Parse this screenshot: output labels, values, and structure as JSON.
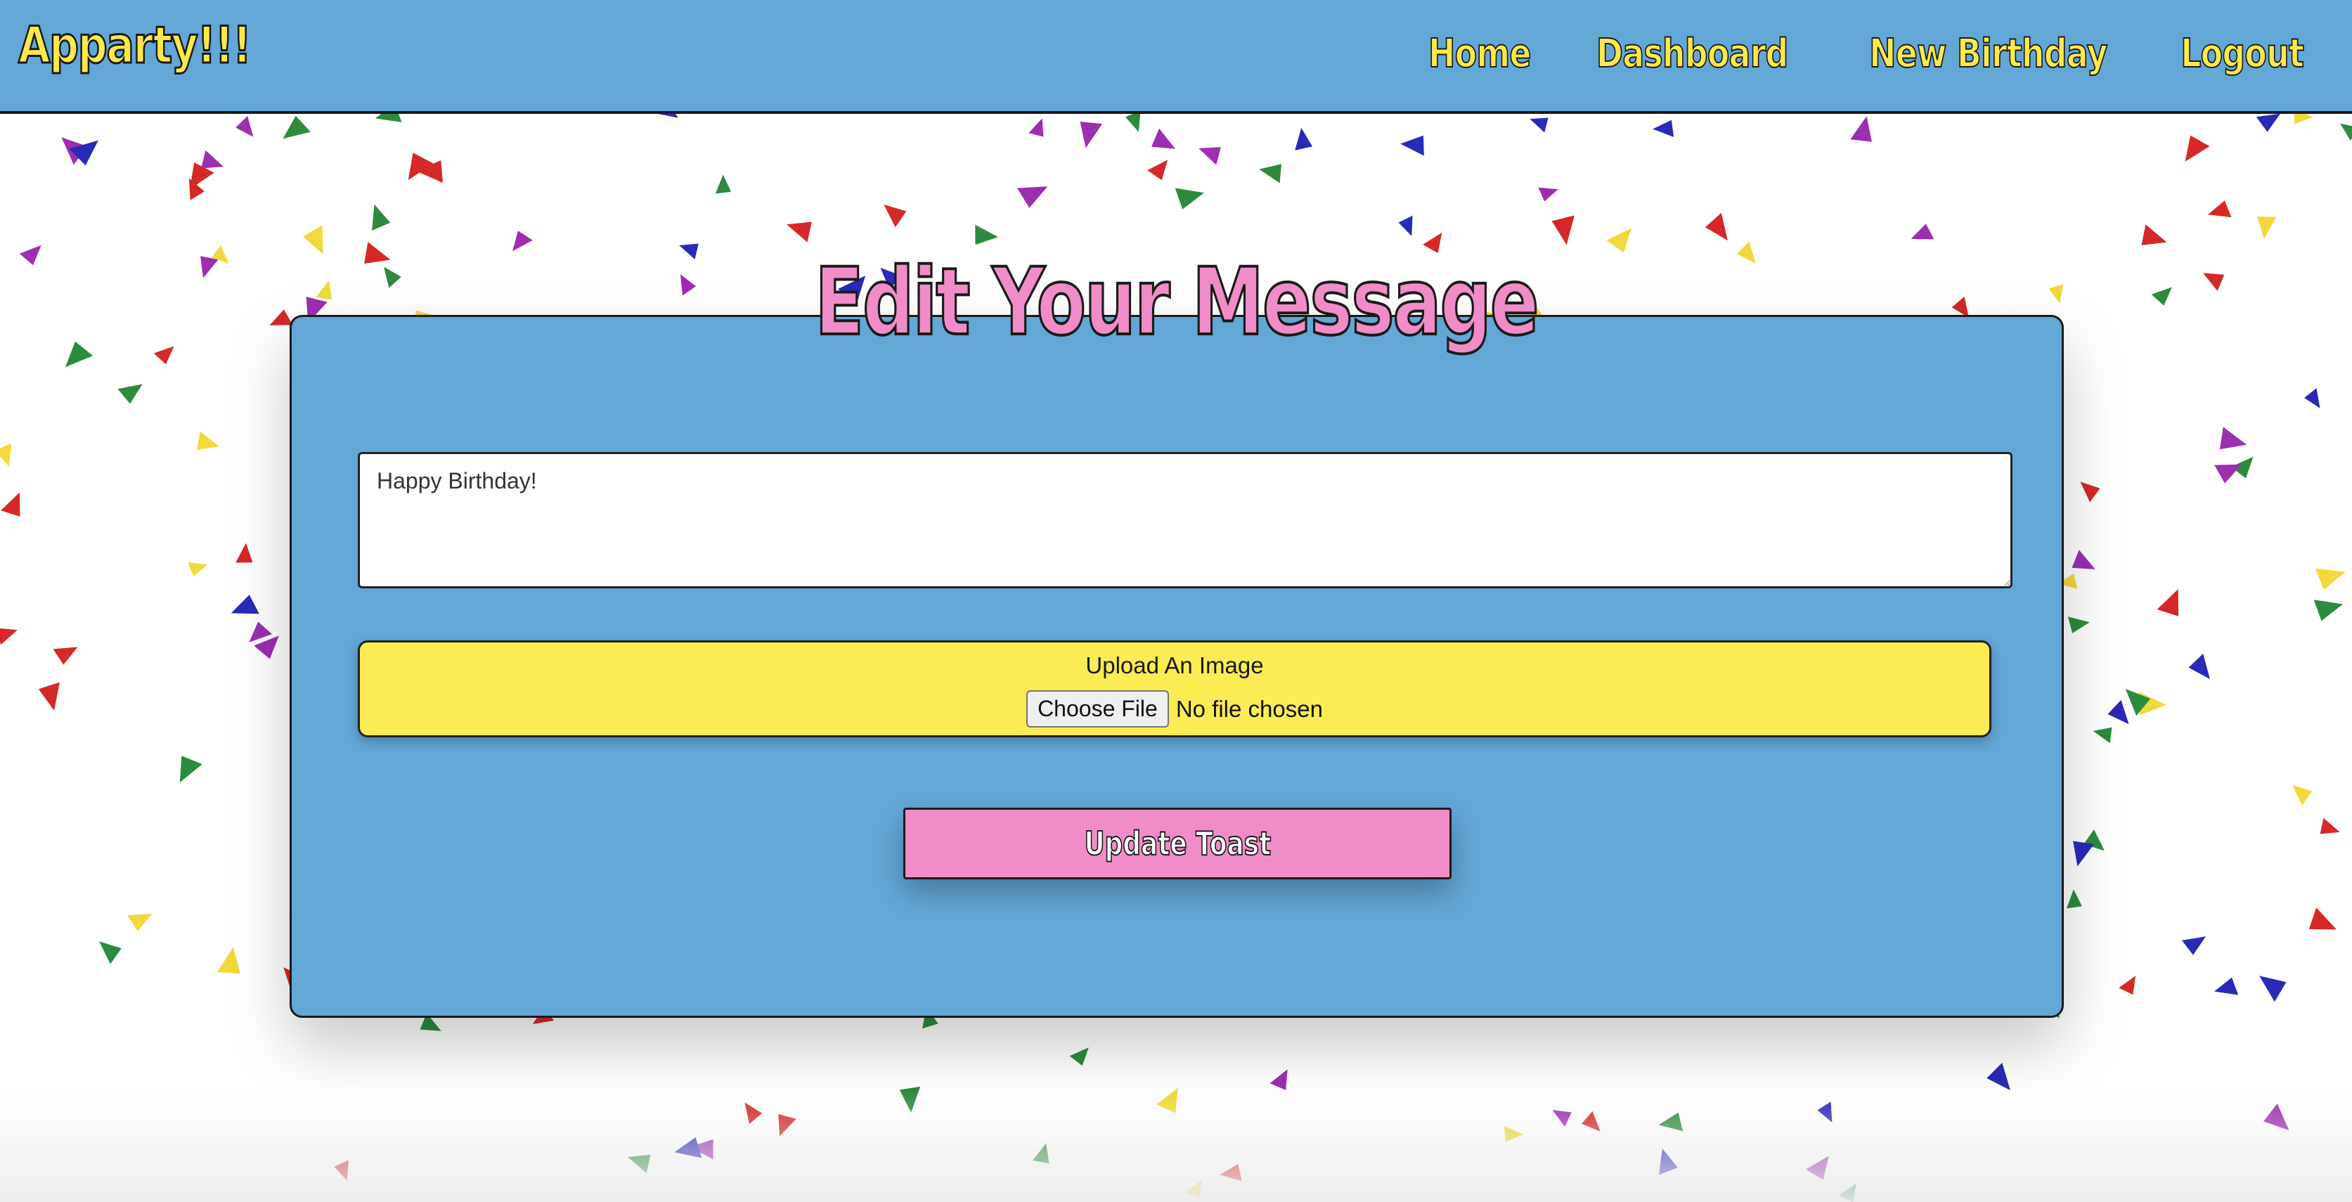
{
  "navbar": {
    "brand": "Apparty!!!",
    "links": [
      {
        "label": "Home"
      },
      {
        "label": "Dashboard"
      },
      {
        "label": "New Birthday"
      },
      {
        "label": "Logout"
      }
    ]
  },
  "page": {
    "title": "Edit Your Message"
  },
  "form": {
    "message_value": "Happy Birthday!",
    "upload_label": "Upload An Image",
    "choose_file_label": "Choose File",
    "file_status": "No file chosen",
    "submit_label": "Update Toast"
  },
  "colors": {
    "nav_background": "#63a7d7",
    "brand_yellow": "#fbe94b",
    "title_pink": "#f08dc8",
    "card_blue": "#63a7d7",
    "upload_yellow": "#fcec54",
    "button_pink": "#f08dc8",
    "confetti": [
      "#d62828",
      "#2a2ab8",
      "#2e8b3e",
      "#9b2fb0",
      "#f2d93b"
    ]
  }
}
